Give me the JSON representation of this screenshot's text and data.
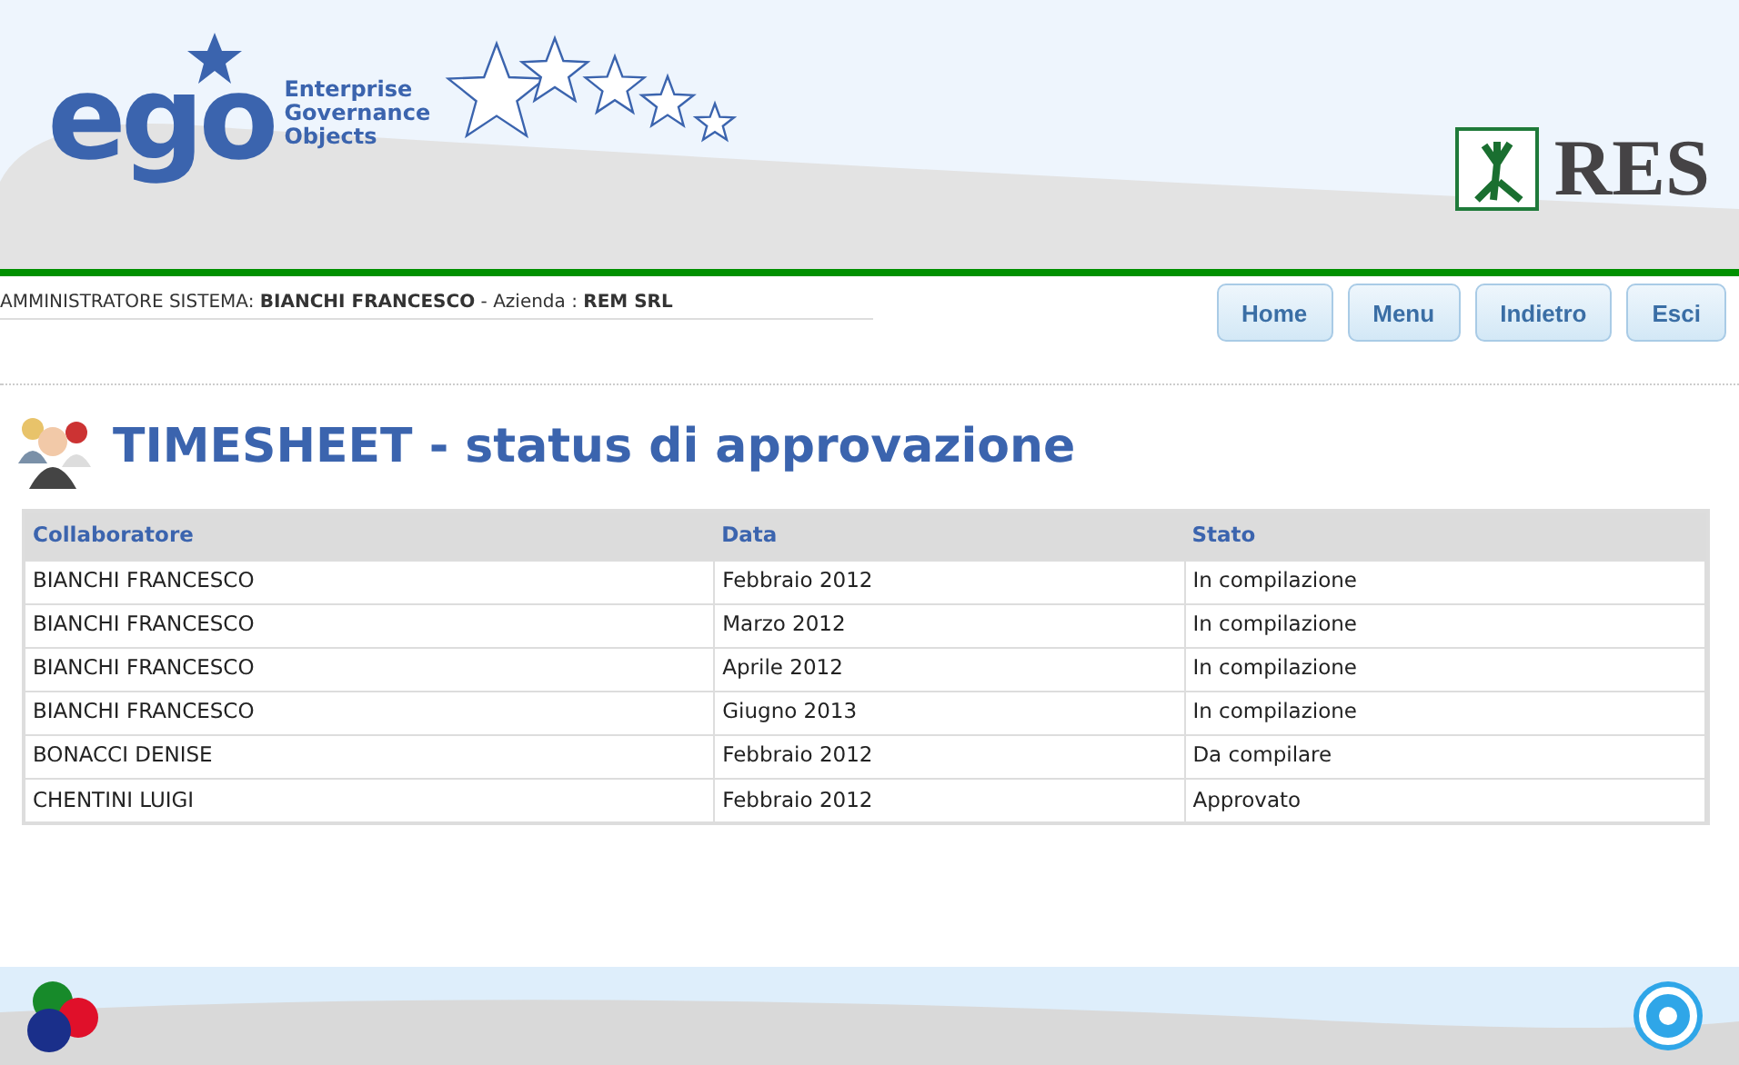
{
  "header": {
    "logo_word": "ego",
    "logo_tagline": [
      "Enterprise",
      "Governance",
      "Objects"
    ],
    "partner_logo": "RES"
  },
  "user_bar": {
    "role": "AMMINISTRATORE SISTEMA:",
    "user": "BIANCHI FRANCESCO",
    "separator": "- Azienda :",
    "company": "REM SRL"
  },
  "nav_buttons": [
    "Home",
    "Menu",
    "Indietro",
    "Esci"
  ],
  "page_title": {
    "main": "TIMESHEET",
    "rest": "- status di approvazione"
  },
  "table": {
    "columns": [
      "Collaboratore",
      "Data",
      "Stato"
    ],
    "rows": [
      [
        "BIANCHI FRANCESCO",
        "Febbraio 2012",
        "In compilazione"
      ],
      [
        "BIANCHI FRANCESCO",
        "Marzo 2012",
        "In compilazione"
      ],
      [
        "BIANCHI FRANCESCO",
        "Aprile 2012",
        "In compilazione"
      ],
      [
        "BIANCHI FRANCESCO",
        "Giugno 2013",
        "In compilazione"
      ],
      [
        "BONACCI DENISE",
        "Febbraio 2012",
        "Da compilare"
      ],
      [
        "CHENTINI LUIGI",
        "Febbraio 2012",
        "Approvato"
      ]
    ]
  }
}
